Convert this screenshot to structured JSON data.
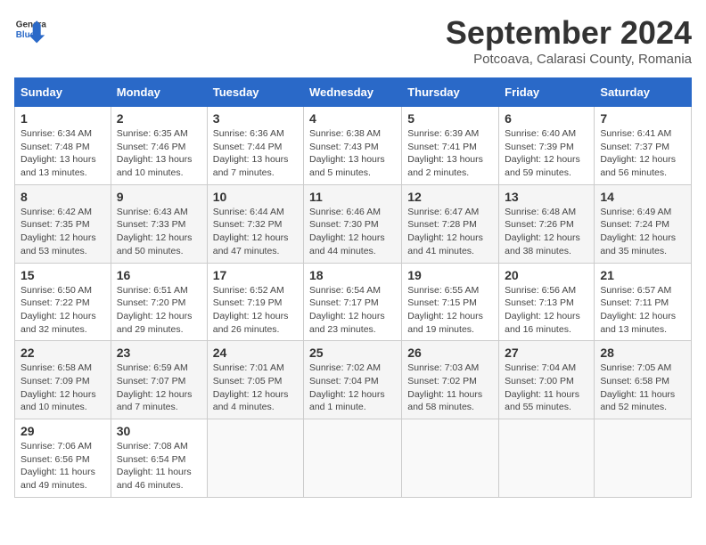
{
  "logo": {
    "line1": "General",
    "line2": "Blue"
  },
  "title": "September 2024",
  "subtitle": "Potcoava, Calarasi County, Romania",
  "weekdays": [
    "Sunday",
    "Monday",
    "Tuesday",
    "Wednesday",
    "Thursday",
    "Friday",
    "Saturday"
  ],
  "weeks": [
    [
      {
        "day": "1",
        "info": "Sunrise: 6:34 AM\nSunset: 7:48 PM\nDaylight: 13 hours\nand 13 minutes."
      },
      {
        "day": "2",
        "info": "Sunrise: 6:35 AM\nSunset: 7:46 PM\nDaylight: 13 hours\nand 10 minutes."
      },
      {
        "day": "3",
        "info": "Sunrise: 6:36 AM\nSunset: 7:44 PM\nDaylight: 13 hours\nand 7 minutes."
      },
      {
        "day": "4",
        "info": "Sunrise: 6:38 AM\nSunset: 7:43 PM\nDaylight: 13 hours\nand 5 minutes."
      },
      {
        "day": "5",
        "info": "Sunrise: 6:39 AM\nSunset: 7:41 PM\nDaylight: 13 hours\nand 2 minutes."
      },
      {
        "day": "6",
        "info": "Sunrise: 6:40 AM\nSunset: 7:39 PM\nDaylight: 12 hours\nand 59 minutes."
      },
      {
        "day": "7",
        "info": "Sunrise: 6:41 AM\nSunset: 7:37 PM\nDaylight: 12 hours\nand 56 minutes."
      }
    ],
    [
      {
        "day": "8",
        "info": "Sunrise: 6:42 AM\nSunset: 7:35 PM\nDaylight: 12 hours\nand 53 minutes."
      },
      {
        "day": "9",
        "info": "Sunrise: 6:43 AM\nSunset: 7:33 PM\nDaylight: 12 hours\nand 50 minutes."
      },
      {
        "day": "10",
        "info": "Sunrise: 6:44 AM\nSunset: 7:32 PM\nDaylight: 12 hours\nand 47 minutes."
      },
      {
        "day": "11",
        "info": "Sunrise: 6:46 AM\nSunset: 7:30 PM\nDaylight: 12 hours\nand 44 minutes."
      },
      {
        "day": "12",
        "info": "Sunrise: 6:47 AM\nSunset: 7:28 PM\nDaylight: 12 hours\nand 41 minutes."
      },
      {
        "day": "13",
        "info": "Sunrise: 6:48 AM\nSunset: 7:26 PM\nDaylight: 12 hours\nand 38 minutes."
      },
      {
        "day": "14",
        "info": "Sunrise: 6:49 AM\nSunset: 7:24 PM\nDaylight: 12 hours\nand 35 minutes."
      }
    ],
    [
      {
        "day": "15",
        "info": "Sunrise: 6:50 AM\nSunset: 7:22 PM\nDaylight: 12 hours\nand 32 minutes."
      },
      {
        "day": "16",
        "info": "Sunrise: 6:51 AM\nSunset: 7:20 PM\nDaylight: 12 hours\nand 29 minutes."
      },
      {
        "day": "17",
        "info": "Sunrise: 6:52 AM\nSunset: 7:19 PM\nDaylight: 12 hours\nand 26 minutes."
      },
      {
        "day": "18",
        "info": "Sunrise: 6:54 AM\nSunset: 7:17 PM\nDaylight: 12 hours\nand 23 minutes."
      },
      {
        "day": "19",
        "info": "Sunrise: 6:55 AM\nSunset: 7:15 PM\nDaylight: 12 hours\nand 19 minutes."
      },
      {
        "day": "20",
        "info": "Sunrise: 6:56 AM\nSunset: 7:13 PM\nDaylight: 12 hours\nand 16 minutes."
      },
      {
        "day": "21",
        "info": "Sunrise: 6:57 AM\nSunset: 7:11 PM\nDaylight: 12 hours\nand 13 minutes."
      }
    ],
    [
      {
        "day": "22",
        "info": "Sunrise: 6:58 AM\nSunset: 7:09 PM\nDaylight: 12 hours\nand 10 minutes."
      },
      {
        "day": "23",
        "info": "Sunrise: 6:59 AM\nSunset: 7:07 PM\nDaylight: 12 hours\nand 7 minutes."
      },
      {
        "day": "24",
        "info": "Sunrise: 7:01 AM\nSunset: 7:05 PM\nDaylight: 12 hours\nand 4 minutes."
      },
      {
        "day": "25",
        "info": "Sunrise: 7:02 AM\nSunset: 7:04 PM\nDaylight: 12 hours\nand 1 minute."
      },
      {
        "day": "26",
        "info": "Sunrise: 7:03 AM\nSunset: 7:02 PM\nDaylight: 11 hours\nand 58 minutes."
      },
      {
        "day": "27",
        "info": "Sunrise: 7:04 AM\nSunset: 7:00 PM\nDaylight: 11 hours\nand 55 minutes."
      },
      {
        "day": "28",
        "info": "Sunrise: 7:05 AM\nSunset: 6:58 PM\nDaylight: 11 hours\nand 52 minutes."
      }
    ],
    [
      {
        "day": "29",
        "info": "Sunrise: 7:06 AM\nSunset: 6:56 PM\nDaylight: 11 hours\nand 49 minutes."
      },
      {
        "day": "30",
        "info": "Sunrise: 7:08 AM\nSunset: 6:54 PM\nDaylight: 11 hours\nand 46 minutes."
      },
      null,
      null,
      null,
      null,
      null
    ]
  ]
}
